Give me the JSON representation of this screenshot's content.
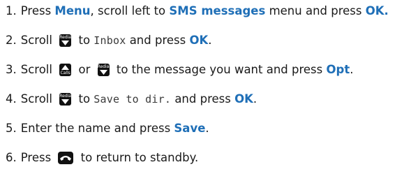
{
  "steps": [
    {
      "num": "1.",
      "t1": "Press ",
      "b1": "Menu",
      "t2": ", scroll left to ",
      "b2": "SMS messages",
      "t3": " menu and press ",
      "b3": "OK."
    },
    {
      "num": "2.",
      "t1": "Scroll ",
      "icon1": "redial-down-key",
      "t2": " to ",
      "lcd": "Inbox",
      "t3": " and press ",
      "b1": "OK",
      "t4": "."
    },
    {
      "num": "3.",
      "t1": "Scroll ",
      "icon1": "calls-up-key",
      "t2": " or ",
      "icon2": "redial-down-key",
      "t3": " to the message you want and press ",
      "b1": "Opt",
      "t4": "."
    },
    {
      "num": "4.",
      "t1": "Scroll ",
      "icon1": "redial-down-key",
      "t2": " to ",
      "lcd": "Save to dir.",
      "t3": " and press ",
      "b1": "OK",
      "t4": "."
    },
    {
      "num": "5.",
      "t1": "Enter the name and press ",
      "b1": "Save",
      "t2": "."
    },
    {
      "num": "6.",
      "t1": "Press ",
      "icon1": "end-call-key",
      "t2": " to return to standby."
    }
  ],
  "keys": {
    "redial_label": "Redial",
    "calls_label": "Calls"
  },
  "colors": {
    "highlight": "#1f6fb7",
    "text": "#1a1a1a",
    "key": "#111111"
  }
}
